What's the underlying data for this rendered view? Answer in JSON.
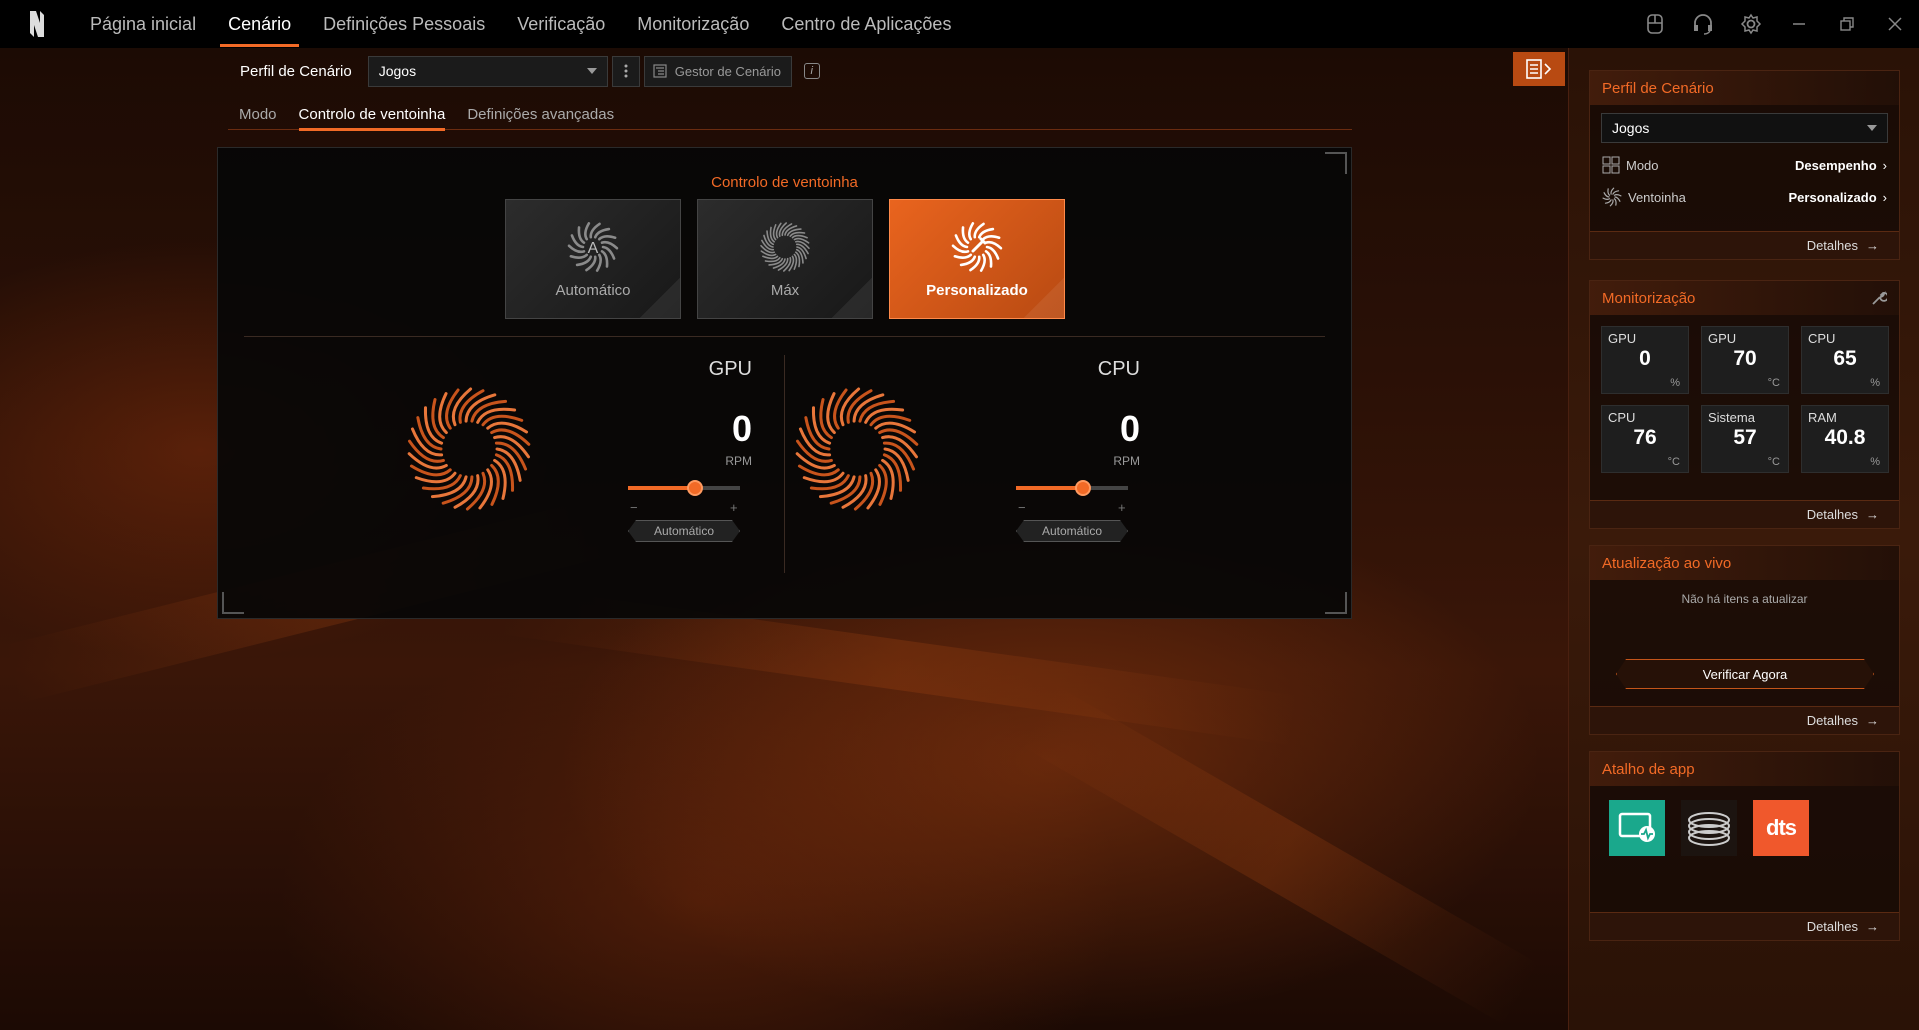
{
  "nav": {
    "items": [
      "Página inicial",
      "Cenário",
      "Definições Pessoais",
      "Verificação",
      "Monitorização",
      "Centro de Aplicações"
    ],
    "active_index": 1
  },
  "window_controls": [
    "keyboard-icon",
    "headset-icon",
    "gear-icon",
    "minimize-icon",
    "restore-icon",
    "close-icon"
  ],
  "profile": {
    "label": "Perfil de Cenário",
    "value": "Jogos",
    "manager_label": "Gestor de Cenário"
  },
  "subtabs": {
    "items": [
      "Modo",
      "Controlo de ventoinha",
      "Definições avançadas"
    ],
    "active_index": 1
  },
  "fan_control": {
    "title": "Controlo de ventoinha",
    "modes": [
      "Automático",
      "Máx",
      "Personalizado"
    ],
    "active_mode_index": 2,
    "fans": [
      {
        "name": "GPU",
        "value": "0",
        "unit": "RPM",
        "slider_level": 0.6,
        "minus": "−",
        "plus": "+",
        "button": "Automático"
      },
      {
        "name": "CPU",
        "value": "0",
        "unit": "RPM",
        "slider_level": 0.6,
        "minus": "−",
        "plus": "+",
        "button": "Automático"
      }
    ]
  },
  "sidebar": {
    "profile_card": {
      "title": "Perfil de Cenário",
      "select_value": "Jogos",
      "rows": [
        {
          "label": "Modo",
          "value": "Desempenho"
        },
        {
          "label": "Ventoinha",
          "value": "Personalizado"
        }
      ],
      "details": "Detalhes"
    },
    "monitor_card": {
      "title": "Monitorização",
      "metrics": [
        {
          "label": "GPU",
          "value": "0",
          "unit": "%"
        },
        {
          "label": "GPU",
          "value": "70",
          "unit": "°C"
        },
        {
          "label": "CPU",
          "value": "65",
          "unit": "%"
        },
        {
          "label": "CPU",
          "value": "76",
          "unit": "°C"
        },
        {
          "label": "Sistema",
          "value": "57",
          "unit": "°C"
        },
        {
          "label": "RAM",
          "value": "40.8",
          "unit": "%"
        }
      ],
      "details": "Detalhes"
    },
    "update_card": {
      "title": "Atualização ao vivo",
      "message": "Não há itens a atualizar",
      "button": "Verificar Agora",
      "details": "Detalhes"
    },
    "apps_card": {
      "title": "Atalho de app",
      "apps": [
        "monitor-app-icon",
        "coil-app-icon",
        "dts-app-icon"
      ],
      "dts_text": "dts",
      "details": "Detalhes"
    }
  },
  "colors": {
    "accent": "#f26a26",
    "accent_dark": "#b84a12",
    "bg": "#000000"
  }
}
